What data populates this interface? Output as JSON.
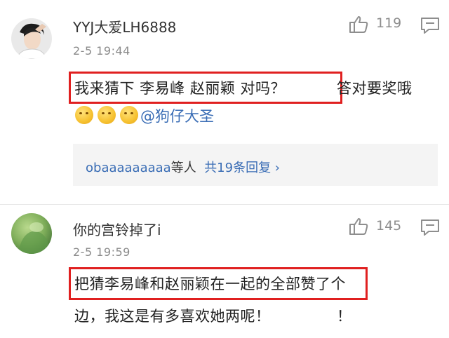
{
  "comments": [
    {
      "username": "YYJ大爱LH6888",
      "timestamp": "2-5 19:44",
      "like_count": "119",
      "text_highlighted": "我来猜下 李易峰 赵丽颖 对吗？",
      "text_tail": "答对要奖哦",
      "mention": "@狗仔大圣",
      "emoji": "thinking-face",
      "replies": {
        "user": "obaaaaaaaaa",
        "mid": "等人",
        "link": "共19条回复 ›"
      }
    },
    {
      "username": "你的宫铃掉了i",
      "timestamp": "2-5 19:59",
      "like_count": "145",
      "text_line1": "把猜李易峰和赵丽颖在一起的全部赞了个",
      "text_line2": "边，我这是有多喜欢她两呢！",
      "text_line2_tail": "！"
    }
  ],
  "colors": {
    "highlight": "#e02020",
    "link": "#3a6db5",
    "meta": "#8a8a8a"
  }
}
